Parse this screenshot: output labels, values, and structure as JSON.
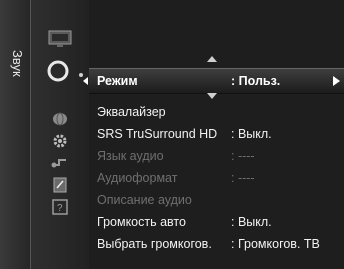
{
  "side_tab": {
    "label": "Звук"
  },
  "menu": {
    "items": [
      {
        "label": "Режим",
        "value": ": Польз.",
        "selected": true,
        "enabled": true
      },
      {
        "label": "Эквалайзер",
        "value": "",
        "enabled": true
      },
      {
        "label": "SRS TruSurround HD",
        "value": ": Выкл.",
        "enabled": true
      },
      {
        "label": "Язык аудио",
        "value": ": ----",
        "enabled": false
      },
      {
        "label": "Аудиоформат",
        "value": ": ----",
        "enabled": false
      },
      {
        "label": "Описание аудио",
        "value": "",
        "enabled": false
      },
      {
        "label": "Громкость авто",
        "value": ": Выкл.",
        "enabled": true
      },
      {
        "label": "Выбрать громкогов.",
        "value": ": Громкогов. ТВ",
        "enabled": true
      }
    ]
  },
  "icons": [
    "picture-icon",
    "sound-icon",
    "channel-icon",
    "setup-icon",
    "input-icon",
    "application-icon",
    "support-icon"
  ]
}
